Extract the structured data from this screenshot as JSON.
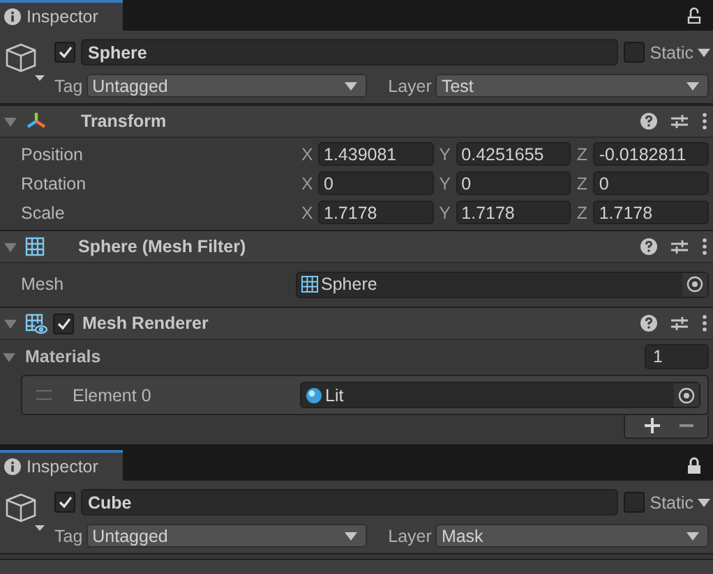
{
  "inspectors": [
    {
      "tab": {
        "title": "Inspector",
        "selected": true
      },
      "locked": false,
      "object": {
        "active": true,
        "name": "Sphere",
        "is_static": false,
        "static_label": "Static",
        "tag_label": "Tag",
        "tag": "Untagged",
        "layer_label": "Layer",
        "layer": "Test"
      },
      "components": [
        {
          "kind": "transform",
          "title": "Transform",
          "expanded": true,
          "rows": [
            {
              "kind": "vector3",
              "label": "Position",
              "axes": [
                {
                  "axis": "X",
                  "value": "1.439081"
                },
                {
                  "axis": "Y",
                  "value": "0.4251655"
                },
                {
                  "axis": "Z",
                  "value": "-0.0182811"
                }
              ]
            },
            {
              "kind": "vector3",
              "label": "Rotation",
              "axes": [
                {
                  "axis": "X",
                  "value": "0"
                },
                {
                  "axis": "Y",
                  "value": "0"
                },
                {
                  "axis": "Z",
                  "value": "0"
                }
              ]
            },
            {
              "kind": "vector3",
              "label": "Scale",
              "axes": [
                {
                  "axis": "X",
                  "value": "1.7178"
                },
                {
                  "axis": "Y",
                  "value": "1.7178"
                },
                {
                  "axis": "Z",
                  "value": "1.7178"
                }
              ]
            }
          ]
        },
        {
          "kind": "mesh_filter",
          "title": "Sphere (Mesh Filter)",
          "expanded": true,
          "rows": [
            {
              "kind": "object",
              "label": "Mesh",
              "value": "Sphere"
            }
          ]
        },
        {
          "kind": "mesh_renderer",
          "title": "Mesh Renderer",
          "expanded": true,
          "enabled": true,
          "rows": [
            {
              "kind": "list",
              "label": "Materials",
              "expanded": true,
              "count": "1",
              "elements": [
                {
                  "label": "Element 0",
                  "value": "Lit"
                }
              ]
            }
          ]
        }
      ]
    },
    {
      "tab": {
        "title": "Inspector",
        "selected": true
      },
      "locked": true,
      "object": {
        "active": true,
        "name": "Cube",
        "is_static": false,
        "static_label": "Static",
        "tag_label": "Tag",
        "tag": "Untagged",
        "layer_label": "Layer",
        "layer": "Mask"
      }
    }
  ]
}
